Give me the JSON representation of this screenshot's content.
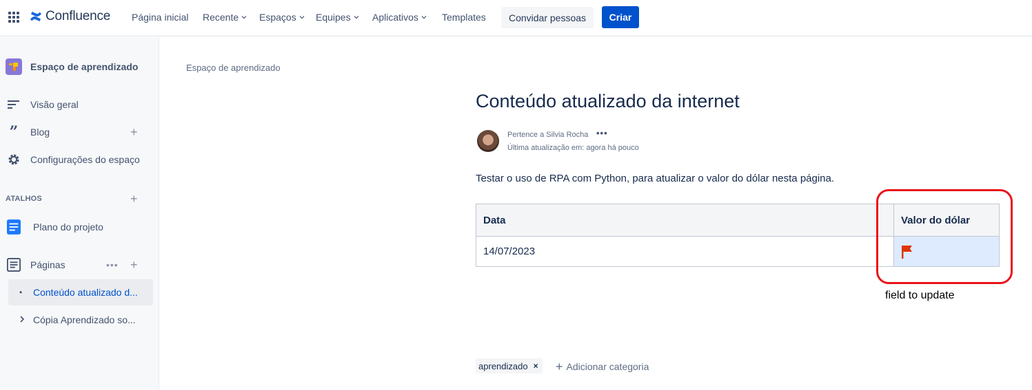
{
  "app": {
    "name": "Confluence",
    "brand_color": "#0052cc"
  },
  "topnav": {
    "items": [
      {
        "label": "Página inicial",
        "has_dropdown": false
      },
      {
        "label": "Recente",
        "has_dropdown": true
      },
      {
        "label": "Espaços",
        "has_dropdown": true
      },
      {
        "label": "Equipes",
        "has_dropdown": true
      },
      {
        "label": "Aplicativos",
        "has_dropdown": true
      },
      {
        "label": "Templates",
        "has_dropdown": false
      }
    ],
    "invite_label": "Convidar pessoas",
    "create_label": "Criar"
  },
  "sidebar": {
    "space_name": "Espaço de aprendizado",
    "items": [
      {
        "label": "Visão geral",
        "icon": "overview-icon"
      },
      {
        "label": "Blog",
        "icon": "quote-icon"
      },
      {
        "label": "Configurações do espaço",
        "icon": "gear-icon"
      }
    ],
    "shortcuts_label": "ATALHOS",
    "shortcuts": [
      {
        "label": "Plano do projeto",
        "icon": "document-icon"
      }
    ],
    "pages_label": "Páginas",
    "pages": [
      {
        "label": "Conteúdo atualizado d...",
        "active": true
      },
      {
        "label": "Cópia Aprendizado so...",
        "active": false
      }
    ]
  },
  "main": {
    "breadcrumb": "Espaço de aprendizado",
    "title": "Conteúdo atualizado da internet",
    "owner": "Pertence a Silvia Rocha",
    "updated": "Última atualização em: agora há pouco",
    "body": "Testar o uso de RPA com Python, para atualizar o valor do dólar nesta página.",
    "table": {
      "headers": [
        "Data",
        "Valor do dólar"
      ],
      "rows": [
        [
          "14/07/2023",
          ""
        ]
      ]
    },
    "annotation": "field to update",
    "labels": [
      "aprendizado"
    ],
    "add_category": "Adicionar categoria"
  }
}
